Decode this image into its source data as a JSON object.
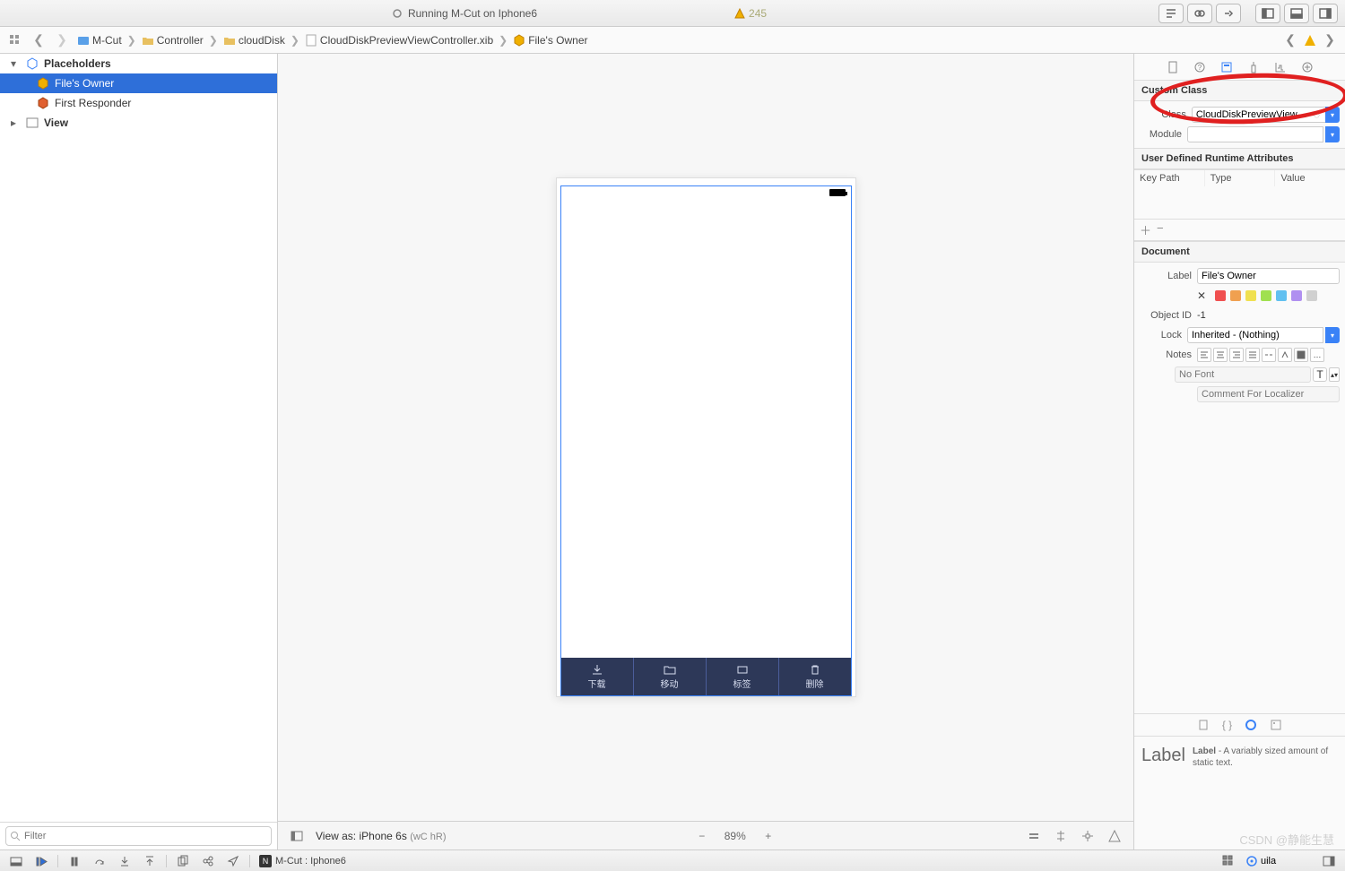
{
  "titlebar": {
    "status_text": "Running M-Cut on Iphone6",
    "warn_count": "245"
  },
  "breadcrumbs": {
    "items": [
      "M-Cut",
      "Controller",
      "cloudDisk",
      "CloudDiskPreviewViewController.xib",
      "File's Owner"
    ]
  },
  "outline": {
    "section_title": "Placeholders",
    "items": [
      {
        "label": "File's Owner"
      },
      {
        "label": "First Responder"
      }
    ],
    "view_row": "View",
    "filter_placeholder": "Filter"
  },
  "canvas": {
    "tabs": [
      "下载",
      "移动",
      "标签",
      "删除"
    ],
    "view_as_label": "View as: iPhone 6s",
    "view_as_sub": "(wC hR)",
    "zoom": "89%"
  },
  "inspector": {
    "custom_class": {
      "title": "Custom Class",
      "class_label": "Class",
      "class_value": "CloudDiskPreviewView…",
      "module_label": "Module"
    },
    "runtime_attrs": {
      "title": "User Defined Runtime Attributes",
      "cols": [
        "Key Path",
        "Type",
        "Value"
      ]
    },
    "document": {
      "title": "Document",
      "label_label": "Label",
      "label_value": "File's Owner",
      "object_id_label": "Object ID",
      "object_id_value": "-1",
      "lock_label": "Lock",
      "lock_value": "Inherited - (Nothing)",
      "notes_label": "Notes",
      "font_placeholder": "No Font",
      "localizer_placeholder": "Comment For Localizer",
      "swatch_colors": [
        "#f05050",
        "#f0a050",
        "#f0e050",
        "#a0e050",
        "#60c0f0",
        "#b090f0",
        "#d0d0d0"
      ]
    },
    "library": {
      "word": "Label",
      "title": "Label",
      "desc": " - A variably sized amount of static text."
    }
  },
  "footer": {
    "target": "M-Cut : Iphone6",
    "lib_search": "uila"
  },
  "watermark": "CSDN @静能生慧"
}
